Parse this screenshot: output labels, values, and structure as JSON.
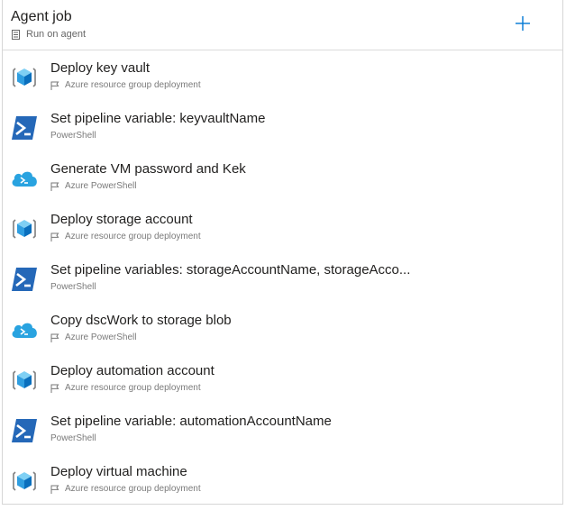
{
  "header": {
    "title": "Agent job",
    "subtitle": "Run on agent"
  },
  "tasks": [
    {
      "name": "Deploy key vault",
      "type": "Azure resource group deployment",
      "icon": "azure-resource-group-icon",
      "flag": true
    },
    {
      "name": "Set pipeline variable: keyvaultName",
      "type": "PowerShell",
      "icon": "powershell-icon",
      "flag": false
    },
    {
      "name": "Generate VM password and Kek",
      "type": "Azure PowerShell",
      "icon": "azure-powershell-icon",
      "flag": true
    },
    {
      "name": "Deploy storage account",
      "type": "Azure resource group deployment",
      "icon": "azure-resource-group-icon",
      "flag": true
    },
    {
      "name": "Set pipeline variables: storageAccountName, storageAcco...",
      "type": "PowerShell",
      "icon": "powershell-icon",
      "flag": false
    },
    {
      "name": "Copy dscWork to storage blob",
      "type": "Azure PowerShell",
      "icon": "azure-powershell-icon",
      "flag": true
    },
    {
      "name": "Deploy automation account",
      "type": "Azure resource group deployment",
      "icon": "azure-resource-group-icon",
      "flag": true
    },
    {
      "name": "Set pipeline variable: automationAccountName",
      "type": "PowerShell",
      "icon": "powershell-icon",
      "flag": false
    },
    {
      "name": "Deploy virtual machine",
      "type": "Azure resource group deployment",
      "icon": "azure-resource-group-icon",
      "flag": true
    }
  ],
  "colors": {
    "accent": "#0078d4",
    "powershell": "#1f66b4",
    "cloud": "#29a3e0"
  }
}
